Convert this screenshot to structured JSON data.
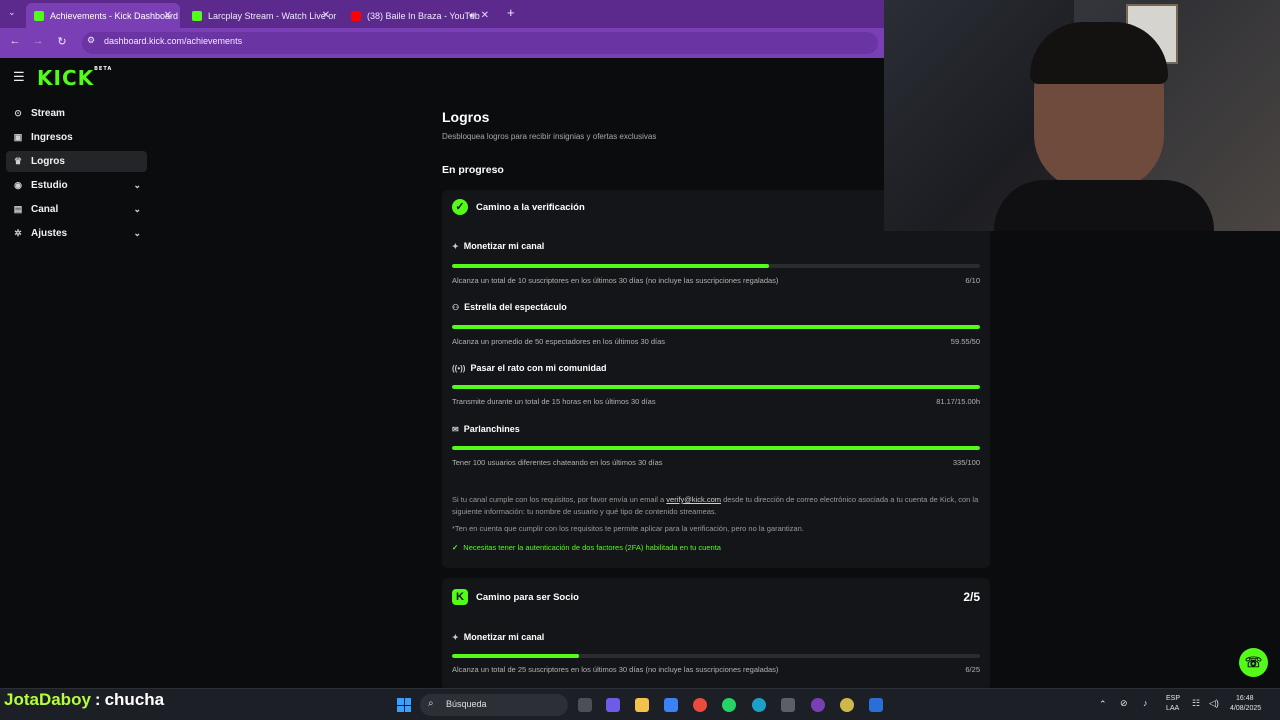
{
  "browser": {
    "tabs": [
      {
        "title": "Achievements - Kick Dashboard",
        "favicon_color": "#53fc18"
      },
      {
        "title": "Larcplay Stream - Watch Live or",
        "favicon_color": "#53fc18"
      },
      {
        "title": "(38) Baile In Braza - YouTub",
        "favicon_color": "#ff0000"
      }
    ],
    "new_tab": "+",
    "url": "dashboard.kick.com/achievements"
  },
  "sidebar": {
    "logo": "KICK",
    "logo_badge": "BETA",
    "items": [
      {
        "label": "Stream",
        "icon": "stream-icon",
        "glyph": "⊙",
        "active": false,
        "expandable": false
      },
      {
        "label": "Ingresos",
        "icon": "money-icon",
        "glyph": "▣",
        "active": false,
        "expandable": false
      },
      {
        "label": "Logros",
        "icon": "trophy-icon",
        "glyph": "♛",
        "active": true,
        "expandable": false
      },
      {
        "label": "Estudio",
        "icon": "studio-icon",
        "glyph": "◉",
        "active": false,
        "expandable": true
      },
      {
        "label": "Canal",
        "icon": "channel-icon",
        "glyph": "▤",
        "active": false,
        "expandable": true
      },
      {
        "label": "Ajustes",
        "icon": "settings-icon",
        "glyph": "✲",
        "active": false,
        "expandable": true
      }
    ]
  },
  "main": {
    "title": "Logros",
    "subtitle": "Desbloquea logros para recibir insignias y ofertas exclusivas",
    "section": "En progreso",
    "verification": {
      "title": "Camino a la verificación",
      "achievements": [
        {
          "title": "Monetizar mi canal",
          "icon": "spark-icon",
          "glyph": "✦",
          "progress": 0.6,
          "desc": "Alcanza un total de 10 suscriptores en los últimos 30 días (no incluye las suscripciones regaladas)",
          "value": "6/10"
        },
        {
          "title": "Estrella del espectáculo",
          "icon": "users-icon",
          "glyph": "⚇",
          "progress": 1.0,
          "desc": "Alcanza un promedio de 50 espectadores en los últimos 30 días",
          "value": "59.55/50"
        },
        {
          "title": "Pasar el rato con mi comunidad",
          "icon": "broadcast-icon",
          "glyph": "((•))",
          "progress": 1.0,
          "desc": "Transmite durante un total de 15 horas en los últimos 30 días",
          "value": "81.17/15.00h"
        },
        {
          "title": "Parlanchines",
          "icon": "chat-icon",
          "glyph": "✉",
          "progress": 1.0,
          "desc": "Tener 100 usuarios diferentes chateando en los últimos 30 días",
          "value": "335/100"
        }
      ],
      "note_prefix": "Si tu canal cumple con los requisitos, por favor envía un email a",
      "note_email": "verify@kick.com",
      "note_suffix": "desde tu dirección de correo electrónico asociada a tu cuenta de Kick, con la siguiente información: tu nombre de usuario y qué tipo de contenido streameas.",
      "disclaimer": "*Ten en cuenta que cumplir con los requisitos te permite aplicar para la verificación, pero no la garantizan.",
      "requirement": "Necesitas tener la autenticación de dos factores (2FA) habilitada en tu cuenta"
    },
    "partner": {
      "title": "Camino para ser Socio",
      "count": "2/5",
      "achievements": [
        {
          "title": "Monetizar mi canal",
          "icon": "spark-icon",
          "glyph": "✦",
          "progress": 0.24,
          "desc": "Alcanza un total de 25 suscriptores en los últimos 30 días (no incluye las suscripciones regaladas)",
          "value": "6/25"
        }
      ]
    }
  },
  "overlay": {
    "username": "JotaDaboy",
    "separator": ":",
    "message": "chucha"
  },
  "taskbar": {
    "search_placeholder": "Búsqueda",
    "lang": "ESP",
    "lang2": "LAA",
    "time": "16:48",
    "date": "4/08/2025"
  },
  "colors": {
    "accent": "#53fc18",
    "browser_purple": "#7a3fb5"
  }
}
